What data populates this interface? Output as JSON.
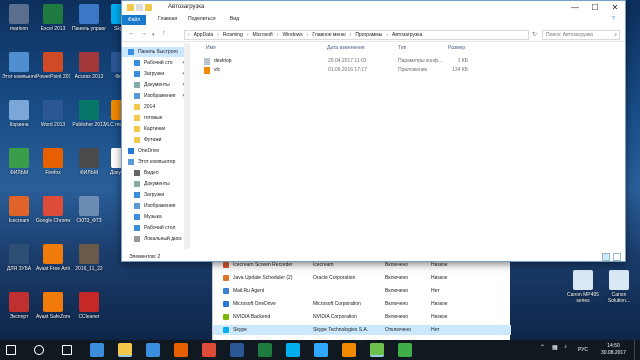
{
  "window": {
    "title": "Автозагрузка",
    "ribbon_tabs": [
      "Файл",
      "Главная",
      "Поделиться",
      "Вид"
    ],
    "minimize": "—",
    "maximize": "☐",
    "close": "✕"
  },
  "address": {
    "path": [
      "AppData",
      "Roaming",
      "Microsoft",
      "Windows",
      "Главное меню",
      "Программы",
      "Автозагрузка"
    ],
    "separator": "›",
    "search_placeholder": "Поиск: Автозагрузка"
  },
  "nav": {
    "items": [
      {
        "label": "Панель быстрого",
        "pinned": false,
        "icon": "star-icon",
        "highlight": true
      },
      {
        "label": "Рабочий сто",
        "pinned": true,
        "icon": "desktop-folder-icon"
      },
      {
        "label": "Загрузки",
        "pinned": true,
        "icon": "downloads-icon"
      },
      {
        "label": "Документы",
        "pinned": true,
        "icon": "documents-icon"
      },
      {
        "label": "Изображения",
        "pinned": true,
        "icon": "pictures-icon"
      },
      {
        "label": "2014",
        "pinned": false,
        "icon": "folder-icon"
      },
      {
        "label": "готовые",
        "pinned": false,
        "icon": "folder-icon"
      },
      {
        "label": "Картинки",
        "pinned": false,
        "icon": "folder-icon"
      },
      {
        "label": "Футажи",
        "pinned": false,
        "icon": "folder-icon"
      },
      {
        "label": "OneDrive",
        "pinned": false,
        "icon": "onedrive-icon"
      },
      {
        "label": "Этот компьютер",
        "pinned": false,
        "icon": "computer-icon"
      },
      {
        "label": "Видео",
        "pinned": false,
        "icon": "videos-icon"
      },
      {
        "label": "Документы",
        "pinned": false,
        "icon": "documents-icon"
      },
      {
        "label": "Загрузки",
        "pinned": false,
        "icon": "downloads-icon"
      },
      {
        "label": "Изображения",
        "pinned": false,
        "icon": "pictures-icon"
      },
      {
        "label": "Музыка",
        "pinned": false,
        "icon": "music-icon"
      },
      {
        "label": "Рабочий стол",
        "pinned": false,
        "icon": "desktop-folder-icon"
      },
      {
        "label": "Локальный диск",
        "pinned": false,
        "icon": "disk-icon"
      }
    ]
  },
  "columns": {
    "name": "Имя",
    "date": "Дата изменения",
    "type": "Тип",
    "size": "Размер"
  },
  "files": [
    {
      "name": "desktop",
      "date": "20.04.2017 11:03",
      "type": "Параметры конф...",
      "size": "1 КБ",
      "icon": "settings-file-icon"
    },
    {
      "name": "vlc",
      "date": "01.06.2016 17:17",
      "type": "Приложение",
      "size": "134 КБ",
      "icon": "vlc-icon"
    }
  ],
  "status": {
    "items_count": "Элементов: 2"
  },
  "startup_list": {
    "rows": [
      {
        "name": "Icecream Screen Recorder",
        "publisher": "Icecream",
        "status": "Включено",
        "impact": "Низкое",
        "color": "#e05a2a"
      },
      {
        "name": "Java Update Scheduler (2)",
        "publisher": "Oracle Corporation",
        "status": "Включено",
        "impact": "Низкое",
        "color": "#d9762a"
      },
      {
        "name": "Mail.Ru Agent",
        "publisher": "",
        "status": "Включено",
        "impact": "Нет",
        "color": "#3d7fd1"
      },
      {
        "name": "Microsoft OneDrive",
        "publisher": "Microsoft Corporation",
        "status": "Включено",
        "impact": "Низкое",
        "color": "#2a78d6"
      },
      {
        "name": "NVIDIA Backend",
        "publisher": "NVIDIA Corporation",
        "status": "Включено",
        "impact": "Низкое",
        "color": "#76b900"
      },
      {
        "name": "Skype",
        "publisher": "Skype Technologies S.A.",
        "status": "Отключено",
        "impact": "Нет",
        "color": "#00aff0",
        "selected": true
      }
    ]
  },
  "desktop_icons": [
    {
      "label": "marionn",
      "color": "#5a6f8f"
    },
    {
      "label": "Этот компьютер",
      "color": "#4f8fd0"
    },
    {
      "label": "Корзина",
      "color": "#7aa7d8"
    },
    {
      "label": "ФИЛЬМ",
      "color": "#3a9d4a"
    },
    {
      "label": "Icecream",
      "color": "#e0642a"
    },
    {
      "label": "ДЛЯ ЗУБА",
      "color": "#2d4f73"
    },
    {
      "label": "Экспорт",
      "color": "#c03030"
    },
    {
      "label": "Excel 2013",
      "color": "#1f7a3f"
    },
    {
      "label": "PowerPoint 2013",
      "color": "#d04a25"
    },
    {
      "label": "Word 2013",
      "color": "#2b5797"
    },
    {
      "label": "Firefox",
      "color": "#e66000"
    },
    {
      "label": "Google Chrome",
      "color": "#dd4b39"
    },
    {
      "label": "Avast Free Antivirus",
      "color": "#f07b0a"
    },
    {
      "label": "Avast SafeZone",
      "color": "#f07b0a"
    },
    {
      "label": "Панель управления",
      "color": "#3a77c4"
    },
    {
      "label": "Access 2013",
      "color": "#a4373a"
    },
    {
      "label": "Publisher 2013",
      "color": "#077568"
    },
    {
      "label": "ФИЛЬМ",
      "color": "#4a4a4a"
    },
    {
      "label": "СКП3_ФТЗ",
      "color": "#6b8cb3"
    },
    {
      "label": "2016_11_22",
      "color": "#6b5a4a"
    },
    {
      "label": "CCleaner",
      "color": "#c62828"
    },
    {
      "label": "Skype",
      "color": "#00aff0"
    },
    {
      "label": "Фото",
      "color": "#2b5797"
    },
    {
      "label": "VLC media player",
      "color": "#f08a00"
    },
    {
      "label": "Документ",
      "color": "#ffffff"
    }
  ],
  "taskbar": {
    "items": [
      {
        "icon": "start-icon",
        "color": "#ffffff"
      },
      {
        "icon": "search-icon",
        "color": "#ffffff"
      },
      {
        "icon": "task-view-icon",
        "color": "#ffffff"
      },
      {
        "icon": "edge-icon",
        "color": "#3b8ede"
      },
      {
        "icon": "explorer-icon",
        "color": "#f2c94c",
        "active": true
      },
      {
        "icon": "store-icon",
        "color": "#3b8ede"
      },
      {
        "icon": "firefox-icon",
        "color": "#e66000"
      },
      {
        "icon": "chrome-icon",
        "color": "#dd4b39"
      },
      {
        "icon": "word-icon",
        "color": "#2b5797"
      },
      {
        "icon": "excel-icon",
        "color": "#1f7a3f"
      },
      {
        "icon": "skype-icon",
        "color": "#00aff0"
      },
      {
        "icon": "photoshop-icon",
        "color": "#31a8ff"
      },
      {
        "icon": "vlc-icon",
        "color": "#f08a00"
      },
      {
        "icon": "taskmgr-icon",
        "color": "#6cbf4a",
        "active": true
      },
      {
        "icon": "camtasia-icon",
        "color": "#3fae49"
      }
    ],
    "lang": "РУС",
    "time": "14:50",
    "date": "30.08.2017"
  },
  "right_panel": [
    {
      "label": "Canon MP495 series",
      "color": "#d8e8f5"
    },
    {
      "label": "Canon Solution...",
      "color": "#d8e8f5"
    }
  ]
}
